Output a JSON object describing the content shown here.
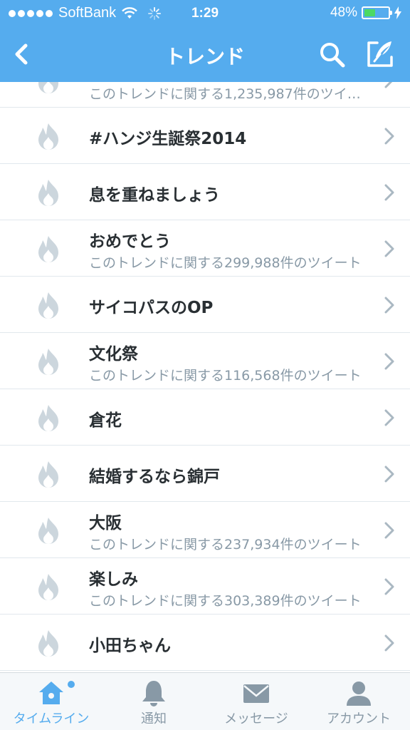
{
  "status": {
    "carrier": "SoftBank",
    "time": "1:29",
    "battery_text": "48%",
    "battery_level": 0.48
  },
  "nav": {
    "title": "トレンド",
    "back_icon": "chevron-left-icon",
    "search_icon": "search-icon",
    "compose_icon": "compose-icon"
  },
  "trends": [
    {
      "title": "",
      "subtitle": "このトレンドに関する1,235,987件のツイート"
    },
    {
      "title": "#ハンジ生誕祭2014",
      "subtitle": ""
    },
    {
      "title": "息を重ねましょう",
      "subtitle": ""
    },
    {
      "title": "おめでとう",
      "subtitle": "このトレンドに関する299,988件のツイート"
    },
    {
      "title": "サイコパスのOP",
      "subtitle": ""
    },
    {
      "title": "文化祭",
      "subtitle": "このトレンドに関する116,568件のツイート"
    },
    {
      "title": "倉花",
      "subtitle": ""
    },
    {
      "title": "結婚するなら錦戸",
      "subtitle": ""
    },
    {
      "title": "大阪",
      "subtitle": "このトレンドに関する237,934件のツイート"
    },
    {
      "title": "楽しみ",
      "subtitle": "このトレンドに関する303,389件のツイート"
    },
    {
      "title": "小田ちゃん",
      "subtitle": ""
    }
  ],
  "tabs": [
    {
      "label": "タイムライン",
      "icon": "home-icon",
      "active": true
    },
    {
      "label": "通知",
      "icon": "bell-icon",
      "active": false
    },
    {
      "label": "メッセージ",
      "icon": "envelope-icon",
      "active": false
    },
    {
      "label": "アカウント",
      "icon": "person-icon",
      "active": false
    }
  ],
  "colors": {
    "brand": "#55acee",
    "icon_gray": "#ccd6dd",
    "text_dark": "#292f33",
    "text_light": "#8899a6",
    "battery": "#4cd964"
  }
}
